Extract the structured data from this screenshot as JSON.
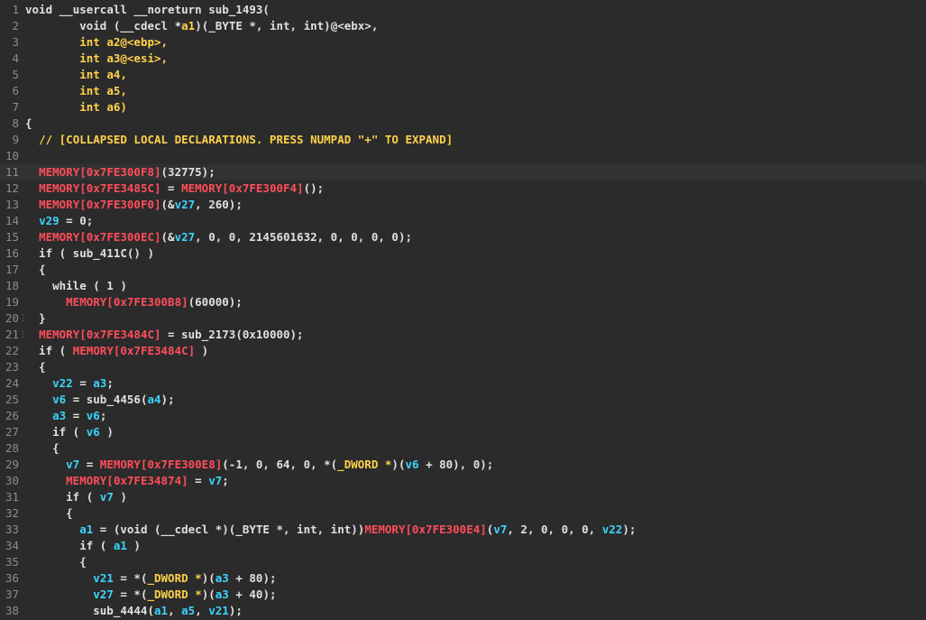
{
  "editor": {
    "title": "",
    "lines": [
      {
        "n": "1",
        "tokens": [
          [
            "kw",
            "void "
          ],
          [
            "plain",
            "__usercall __noreturn sub_1493("
          ]
        ]
      },
      {
        "n": "2",
        "tokens": [
          [
            "plain",
            "        "
          ],
          [
            "kw",
            "void "
          ],
          [
            "plain",
            "(__cdecl *"
          ],
          [
            "type",
            "a1"
          ],
          [
            "plain",
            ")(_BYTE *, int, int)@<ebx>,"
          ]
        ]
      },
      {
        "n": "3",
        "tokens": [
          [
            "plain",
            "        "
          ],
          [
            "type",
            "int a2@<ebp>,"
          ]
        ]
      },
      {
        "n": "4",
        "tokens": [
          [
            "plain",
            "        "
          ],
          [
            "type",
            "int a3@<esi>,"
          ]
        ]
      },
      {
        "n": "5",
        "tokens": [
          [
            "plain",
            "        "
          ],
          [
            "type",
            "int a4,"
          ]
        ]
      },
      {
        "n": "6",
        "tokens": [
          [
            "plain",
            "        "
          ],
          [
            "type",
            "int a5,"
          ]
        ]
      },
      {
        "n": "7",
        "tokens": [
          [
            "plain",
            "        "
          ],
          [
            "type",
            "int a6)"
          ]
        ]
      },
      {
        "n": "8",
        "tokens": [
          [
            "plain",
            "{"
          ]
        ]
      },
      {
        "n": "9",
        "tokens": [
          [
            "plain",
            "  "
          ],
          [
            "cmt",
            "// [COLLAPSED LOCAL DECLARATIONS. PRESS NUMPAD \"+\" TO EXPAND]"
          ]
        ]
      },
      {
        "n": "10",
        "tokens": []
      },
      {
        "n": "11",
        "highlight": true,
        "tokens": [
          [
            "plain",
            "  "
          ],
          [
            "mem",
            "MEMORY[0x7FE300F8]"
          ],
          [
            "plain",
            "(32775);"
          ]
        ]
      },
      {
        "n": "12",
        "tokens": [
          [
            "plain",
            "  "
          ],
          [
            "mem",
            "MEMORY[0x7FE3485C]"
          ],
          [
            "plain",
            " = "
          ],
          [
            "mem",
            "MEMORY[0x7FE300F4]"
          ],
          [
            "plain",
            "();"
          ]
        ]
      },
      {
        "n": "13",
        "tokens": [
          [
            "plain",
            "  "
          ],
          [
            "mem",
            "MEMORY[0x7FE300F0]"
          ],
          [
            "plain",
            "(&"
          ],
          [
            "var",
            "v27"
          ],
          [
            "plain",
            ", 260);"
          ]
        ]
      },
      {
        "n": "14",
        "tokens": [
          [
            "plain",
            "  "
          ],
          [
            "var",
            "v29"
          ],
          [
            "plain",
            " = 0;"
          ]
        ]
      },
      {
        "n": "15",
        "tokens": [
          [
            "plain",
            "  "
          ],
          [
            "mem",
            "MEMORY[0x7FE300EC]"
          ],
          [
            "plain",
            "(&"
          ],
          [
            "var",
            "v27"
          ],
          [
            "plain",
            ", 0, 0, 2145601632, 0, 0, 0, 0);"
          ]
        ]
      },
      {
        "n": "16",
        "tokens": [
          [
            "plain",
            "  if ( sub_411C() )"
          ]
        ]
      },
      {
        "n": "17",
        "tokens": [
          [
            "plain",
            "  {"
          ]
        ]
      },
      {
        "n": "18",
        "tokens": [
          [
            "plain",
            "    while ( 1 )"
          ]
        ]
      },
      {
        "n": "19",
        "tokens": [
          [
            "plain",
            "      "
          ],
          [
            "mem",
            "MEMORY[0x7FE300B8]"
          ],
          [
            "plain",
            "(60000);"
          ]
        ]
      },
      {
        "n": "20",
        "marker": "⋮",
        "tokens": [
          [
            "plain",
            "  }"
          ]
        ]
      },
      {
        "n": "21",
        "marker": "⋮",
        "tokens": [
          [
            "plain",
            "  "
          ],
          [
            "mem",
            "MEMORY[0x7FE3484C]"
          ],
          [
            "plain",
            " = sub_2173(0x10000);"
          ]
        ]
      },
      {
        "n": "22",
        "tokens": [
          [
            "plain",
            "  if ( "
          ],
          [
            "mem",
            "MEMORY[0x7FE3484C]"
          ],
          [
            "plain",
            " )"
          ]
        ]
      },
      {
        "n": "23",
        "tokens": [
          [
            "plain",
            "  {"
          ]
        ]
      },
      {
        "n": "24",
        "tokens": [
          [
            "plain",
            "    "
          ],
          [
            "var",
            "v22"
          ],
          [
            "plain",
            " = "
          ],
          [
            "var",
            "a3"
          ],
          [
            "plain",
            ";"
          ]
        ]
      },
      {
        "n": "25",
        "tokens": [
          [
            "plain",
            "    "
          ],
          [
            "var",
            "v6"
          ],
          [
            "plain",
            " = sub_4456("
          ],
          [
            "var",
            "a4"
          ],
          [
            "plain",
            ");"
          ]
        ]
      },
      {
        "n": "26",
        "tokens": [
          [
            "plain",
            "    "
          ],
          [
            "var",
            "a3"
          ],
          [
            "plain",
            " = "
          ],
          [
            "var",
            "v6"
          ],
          [
            "plain",
            ";"
          ]
        ]
      },
      {
        "n": "27",
        "tokens": [
          [
            "plain",
            "    if ( "
          ],
          [
            "var",
            "v6"
          ],
          [
            "plain",
            " )"
          ]
        ]
      },
      {
        "n": "28",
        "tokens": [
          [
            "plain",
            "    {"
          ]
        ]
      },
      {
        "n": "29",
        "tokens": [
          [
            "plain",
            "      "
          ],
          [
            "var",
            "v7"
          ],
          [
            "plain",
            " = "
          ],
          [
            "mem",
            "MEMORY[0x7FE300E8]"
          ],
          [
            "plain",
            "(-1, 0, 64, 0, *("
          ],
          [
            "type",
            "_DWORD *"
          ],
          [
            "plain",
            ")("
          ],
          [
            "var",
            "v6"
          ],
          [
            "plain",
            " + 80), 0);"
          ]
        ]
      },
      {
        "n": "30",
        "tokens": [
          [
            "plain",
            "      "
          ],
          [
            "mem",
            "MEMORY[0x7FE34874]"
          ],
          [
            "plain",
            " = "
          ],
          [
            "var",
            "v7"
          ],
          [
            "plain",
            ";"
          ]
        ]
      },
      {
        "n": "31",
        "tokens": [
          [
            "plain",
            "      if ( "
          ],
          [
            "var",
            "v7"
          ],
          [
            "plain",
            " )"
          ]
        ]
      },
      {
        "n": "32",
        "tokens": [
          [
            "plain",
            "      {"
          ]
        ]
      },
      {
        "n": "33",
        "tokens": [
          [
            "plain",
            "        "
          ],
          [
            "var",
            "a1"
          ],
          [
            "plain",
            " = (void (__cdecl *)(_BYTE *, int, int))"
          ],
          [
            "mem",
            "MEMORY[0x7FE300E4]"
          ],
          [
            "plain",
            "("
          ],
          [
            "var",
            "v7"
          ],
          [
            "plain",
            ", 2, 0, 0, 0, "
          ],
          [
            "var",
            "v22"
          ],
          [
            "plain",
            ");"
          ]
        ]
      },
      {
        "n": "34",
        "tokens": [
          [
            "plain",
            "        if ( "
          ],
          [
            "var",
            "a1"
          ],
          [
            "plain",
            " )"
          ]
        ]
      },
      {
        "n": "35",
        "tokens": [
          [
            "plain",
            "        {"
          ]
        ]
      },
      {
        "n": "36",
        "tokens": [
          [
            "plain",
            "          "
          ],
          [
            "var",
            "v21"
          ],
          [
            "plain",
            " = *("
          ],
          [
            "type",
            "_DWORD *"
          ],
          [
            "plain",
            ")("
          ],
          [
            "var",
            "a3"
          ],
          [
            "plain",
            " + 80);"
          ]
        ]
      },
      {
        "n": "37",
        "tokens": [
          [
            "plain",
            "          "
          ],
          [
            "var",
            "v27"
          ],
          [
            "plain",
            " = *("
          ],
          [
            "type",
            "_DWORD *"
          ],
          [
            "plain",
            ")("
          ],
          [
            "var",
            "a3"
          ],
          [
            "plain",
            " + 40);"
          ]
        ]
      },
      {
        "n": "38",
        "tokens": [
          [
            "plain",
            "          sub_4444("
          ],
          [
            "var",
            "a1"
          ],
          [
            "plain",
            ", "
          ],
          [
            "var",
            "a5"
          ],
          [
            "plain",
            ", "
          ],
          [
            "var",
            "v21"
          ],
          [
            "plain",
            ");"
          ]
        ]
      }
    ]
  },
  "colors": {
    "background": "#2b2b2b",
    "memory": "#ff4d5a",
    "variable": "#3ad5ff",
    "type": "#ffd24a",
    "comment": "#ffd24a",
    "text": "#e0e0e0",
    "line_number": "#8c8c8c"
  }
}
